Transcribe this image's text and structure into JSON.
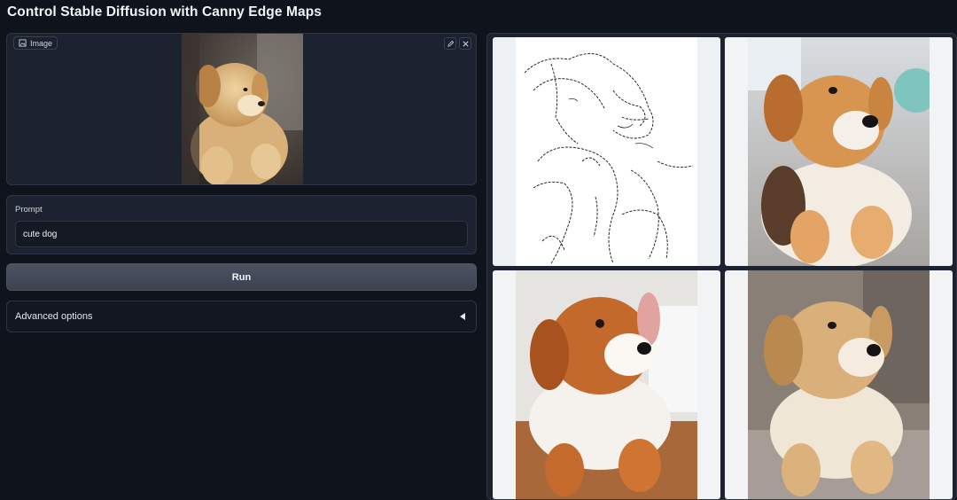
{
  "page": {
    "title": "Control Stable Diffusion with Canny Edge Maps"
  },
  "image_input": {
    "label": "Image",
    "edit_icon": "pencil-icon",
    "clear_icon": "close-icon"
  },
  "prompt": {
    "label": "Prompt",
    "value": "cute dog"
  },
  "run_button": {
    "label": "Run"
  },
  "advanced_options": {
    "label": "Advanced options",
    "icon": "triangle-left-icon"
  },
  "colors": {
    "background": "#0f131b",
    "panel": "#1c2230",
    "border": "#2e3646",
    "button": "#4b5261"
  }
}
